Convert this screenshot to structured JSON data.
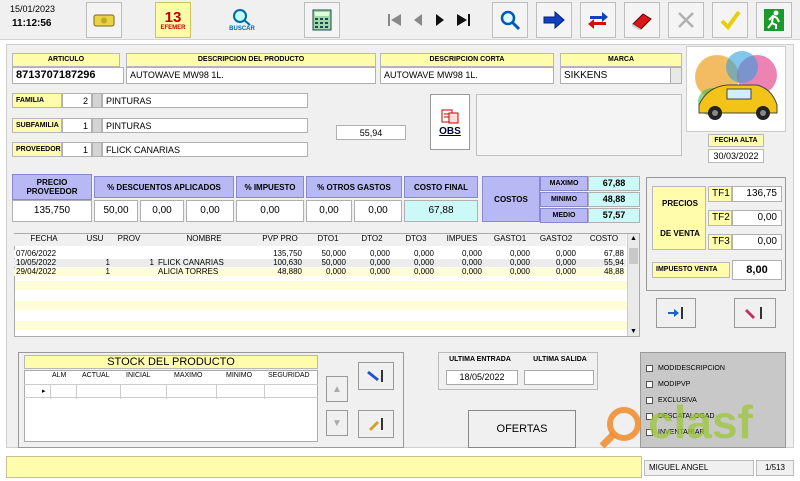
{
  "header": {
    "date": "15/01/2023",
    "time": "11:12:56"
  },
  "toolbar": {
    "calendar_day": "13",
    "calendar_label": "EFEMER",
    "search_label": "BUSCAR"
  },
  "article": {
    "code_label": "ARTICULO",
    "code": "8713707187296",
    "desc_label": "DESCRIPCION DEL PRODUCTO",
    "desc": "AUTOWAVE MW98 1L.",
    "short_label": "DESCRIPCION CORTA",
    "short": "AUTOWAVE MW98 1L.",
    "brand_label": "MARCA",
    "brand": "SIKKENS"
  },
  "classification": {
    "family_label": "FAMILIA",
    "family_code": "2",
    "family_name": "PINTURAS",
    "subfamily_label": "SUBFAMILIA",
    "subfamily_code": "1",
    "subfamily_name": "PINTURAS",
    "supplier_label": "PROVEEDOR",
    "supplier_code": "1",
    "supplier_name": "FLICK CANARIAS",
    "aux_value": "55,94"
  },
  "obs_label": "OBS",
  "photo": {
    "date_label": "FECHA ALTA",
    "date": "30/03/2022"
  },
  "pricing": {
    "supplier_price_label": "PRECIO PROVEEDOR",
    "supplier_price": "135,750",
    "discount_label": "% DESCUENTOS APLICADOS",
    "discounts": [
      "50,00",
      "0,00",
      "0,00"
    ],
    "tax_label": "% IMPUESTO",
    "tax": "0,00",
    "other_label": "% OTROS GASTOS",
    "other": [
      "0,00",
      "0,00"
    ],
    "final_label": "COSTO FINAL",
    "final": "67,88"
  },
  "costs": {
    "label": "COSTOS",
    "max_label": "MAXIMO",
    "max": "67,88",
    "min_label": "MINIMO",
    "min": "48,88",
    "avg_label": "MEDIO",
    "avg": "57,57"
  },
  "sale_prices": {
    "label_1": "PRECIOS",
    "label_2": "DE VENTA",
    "tf1_label": "TF1",
    "tf1": "136,75",
    "tf2_label": "TF2",
    "tf2": "0,00",
    "tf3_label": "TF3",
    "tf3": "0,00",
    "tax_label": "IMPUESTO VENTA",
    "tax": "8,00"
  },
  "history": {
    "columns": [
      "FECHA",
      "USU",
      "PROV",
      "NOMBRE",
      "PVP PRO",
      "DTO1",
      "DTO2",
      "DTO3",
      "IMPUES",
      "GASTO1",
      "GASTO2",
      "COSTO"
    ],
    "rows": [
      [
        "07/06/2022",
        "",
        "",
        "",
        "135,750",
        "50,000",
        "0,000",
        "0,000",
        "0,000",
        "0,000",
        "0,000",
        "67,88"
      ],
      [
        "10/05/2022",
        "1",
        "1",
        "FLICK CANARIAS",
        "100,630",
        "50,000",
        "0,000",
        "0,000",
        "0,000",
        "0,000",
        "0,000",
        "55,94"
      ],
      [
        "29/04/2022",
        "1",
        "",
        "ALICIA TORRES",
        "48,880",
        "0,000",
        "0,000",
        "0,000",
        "0,000",
        "0,000",
        "0,000",
        "48,88"
      ]
    ]
  },
  "stock": {
    "title": "STOCK DEL PRODUCTO",
    "columns": [
      "ALM",
      "ACTUAL",
      "INICIAL",
      "MAXIMO",
      "MINIMO",
      "SEGURIDAD"
    ]
  },
  "movements": {
    "last_in_label": "ULTIMA ENTRADA",
    "last_in": "18/05/2022",
    "last_out_label": "ULTIMA SALIDA",
    "last_out": ""
  },
  "offers_button": "OFERTAS",
  "flags": [
    "MODIDESCRIPCION",
    "MODIPVP",
    "EXCLUSIVA",
    "DESCATALOGAD",
    "INVENTARIAR"
  ],
  "status": {
    "user": "MIGUEL ANGEL",
    "page": "1/513"
  },
  "watermark": "clasf"
}
